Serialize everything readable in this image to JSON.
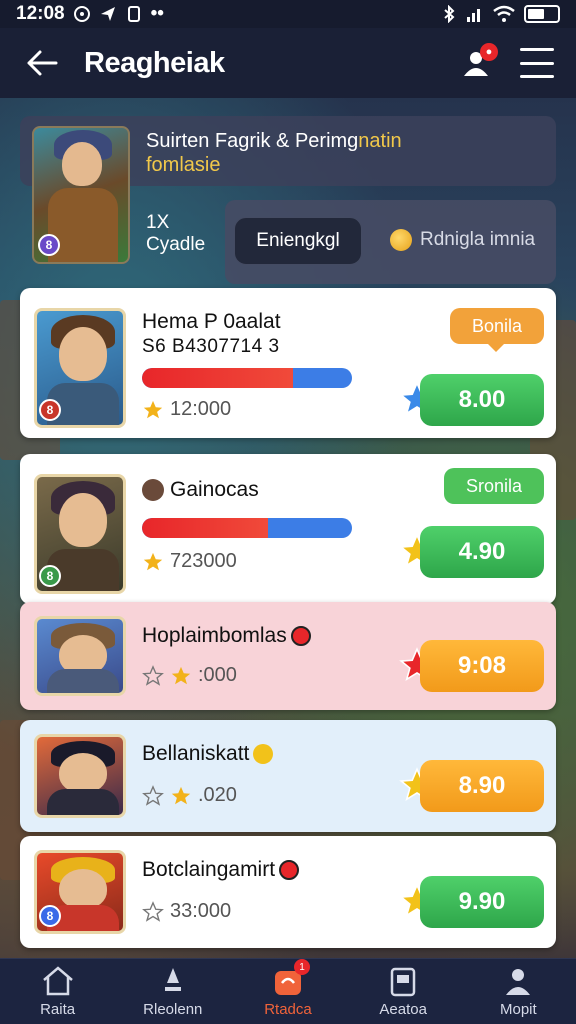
{
  "status_bar": {
    "time": "12:08"
  },
  "header": {
    "title": "Reagheiak"
  },
  "hero": {
    "title_part1": "Suirten Fagrik & Perimg",
    "title_part2": "natin",
    "subtitle": "fomlasie",
    "stat_number": "1X",
    "stat_label": "Cyadle",
    "button_label": "Eniengkgl",
    "link_label": "Rdnigla imnia"
  },
  "list": [
    {
      "name": "Hema P 0aalat",
      "sub": "S6 B4307714 3",
      "progress": 0.72,
      "score": "12:000",
      "tag": "Bonila",
      "value": "8.00",
      "tag_color": "#f2a23a",
      "value_color": "green"
    },
    {
      "name": "Gainocas",
      "sub": "",
      "progress": 0.6,
      "score": "723000",
      "tag": "Sronila",
      "value": "4.90",
      "tag_color": "#4ec25a",
      "value_color": "green"
    },
    {
      "name": "Hoplaimbomlas",
      "sub": "",
      "progress": null,
      "score": ":000",
      "tag": "",
      "value": "9:08",
      "value_color": "orange"
    },
    {
      "name": "Bellaniskatt",
      "sub": "",
      "progress": null,
      "score": ".020",
      "tag": "",
      "value": "8.90",
      "value_color": "orange"
    },
    {
      "name": "Botclaingamirt",
      "sub": "",
      "progress": null,
      "score": "33:000",
      "tag": "",
      "value": "9.90",
      "value_color": "green"
    }
  ],
  "nav": {
    "items": [
      {
        "label": "Raita"
      },
      {
        "label": "Rleolenn"
      },
      {
        "label": "Rtadca",
        "badge": "1"
      },
      {
        "label": "Aeatoa"
      },
      {
        "label": "Mopit"
      }
    ]
  },
  "colors": {
    "accent": "#f0633a",
    "header_bg": "#1a2036"
  }
}
